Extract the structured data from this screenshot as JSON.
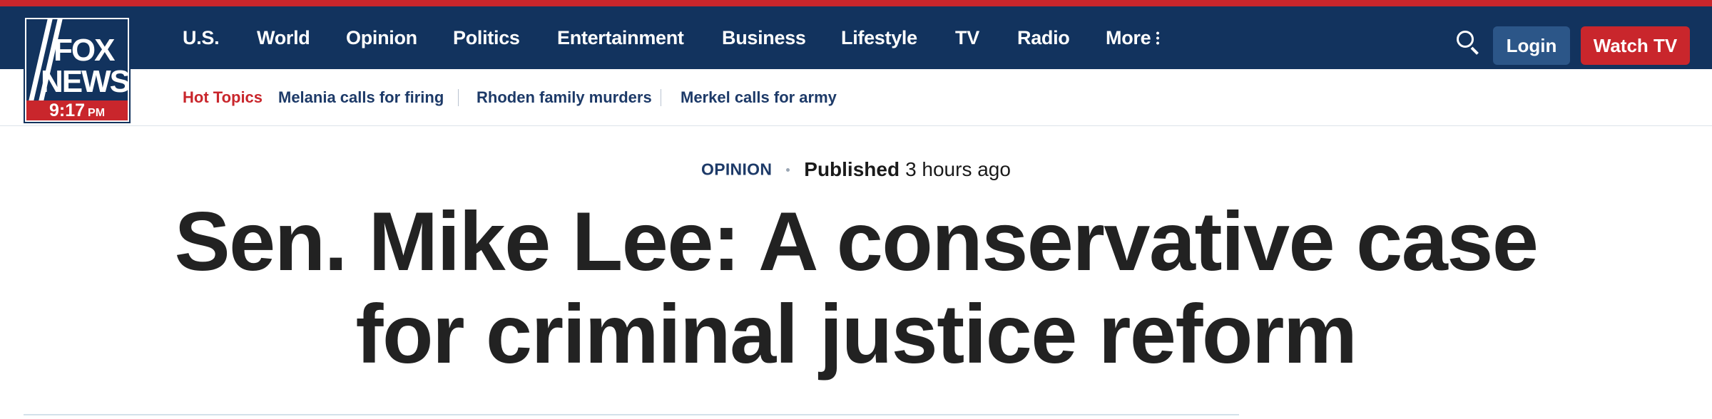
{
  "brand": {
    "logo_line1": "FOX",
    "logo_line2": "NEWS",
    "clock_time": "9:17",
    "clock_period": "PM",
    "colors": {
      "navy": "#12335e",
      "red": "#c9262c",
      "login_blue": "#2c5688"
    }
  },
  "nav": {
    "items": [
      "U.S.",
      "World",
      "Opinion",
      "Politics",
      "Entertainment",
      "Business",
      "Lifestyle",
      "TV",
      "Radio",
      "More"
    ],
    "more_icon": "kebab-vertical-icon",
    "search_icon": "search-icon",
    "login_label": "Login",
    "watch_label": "Watch TV"
  },
  "hot_topics": {
    "label": "Hot Topics",
    "items": [
      "Melania calls for firing",
      "Rhoden family murders",
      "Merkel calls for army"
    ]
  },
  "article": {
    "category": "OPINION",
    "published_label": "Published",
    "published_time": "3 hours ago",
    "headline_line1": "Sen. Mike Lee: A conservative case",
    "headline_line2": "for criminal justice reform"
  }
}
